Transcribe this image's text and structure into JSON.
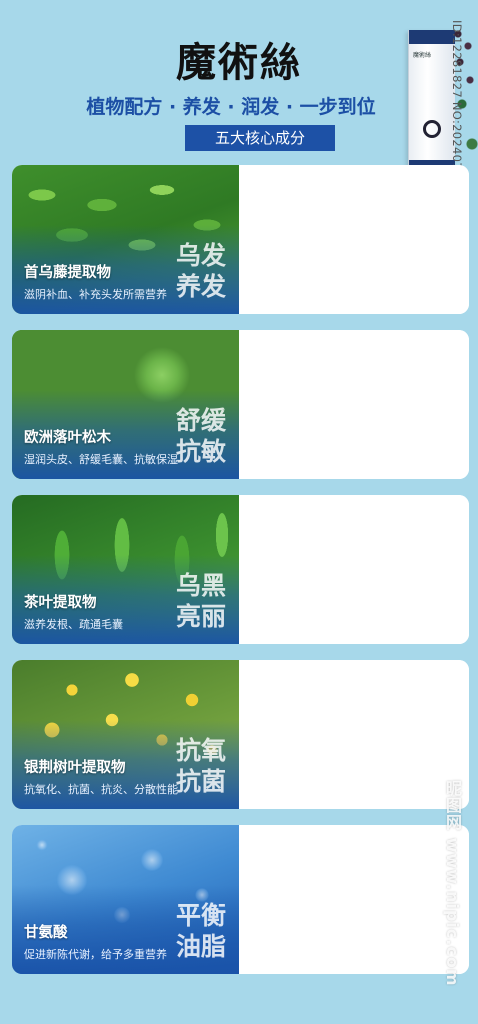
{
  "header": {
    "title": "魔術絲",
    "subtitle": "植物配方 · 养发 · 润发 · 一步到位",
    "badge": "五大核心成分"
  },
  "product": {
    "brand": "魔術絲"
  },
  "watermark": {
    "id": "ID:12281827 NO:20240729102429960104",
    "site": "昵图网 www.nipic.com"
  },
  "ingredients": [
    {
      "name": "首乌藤提取物",
      "desc": "滋阴补血、补充头发所需营养",
      "effect_line1": "乌发",
      "effect_line2": "养发"
    },
    {
      "name": "欧洲落叶松木",
      "desc": "湿润头皮、舒缓毛囊、抗敏保湿",
      "effect_line1": "舒缓",
      "effect_line2": "抗敏"
    },
    {
      "name": "茶叶提取物",
      "desc": "滋养发根、疏通毛囊",
      "effect_line1": "乌黑",
      "effect_line2": "亮丽"
    },
    {
      "name": "银荆树叶提取物",
      "desc": "抗氧化、抗菌、抗炎、分散性能",
      "effect_line1": "抗氧",
      "effect_line2": "抗菌"
    },
    {
      "name": "甘氨酸",
      "desc": "促进新陈代谢，给予多重营养",
      "effect_line1": "平衡",
      "effect_line2": "油脂"
    }
  ]
}
